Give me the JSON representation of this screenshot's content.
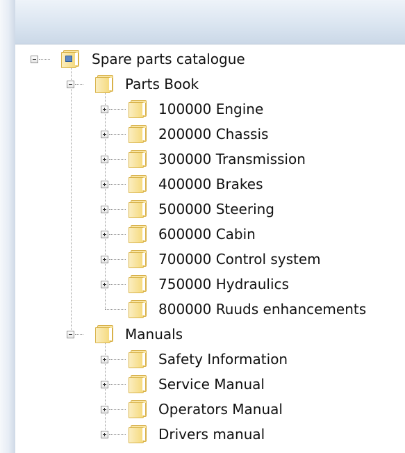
{
  "tree": {
    "root": {
      "label": "Spare parts catalogue"
    },
    "parts_book": {
      "label": "Parts Book",
      "items": [
        {
          "label": "100000 Engine"
        },
        {
          "label": "200000 Chassis"
        },
        {
          "label": "300000 Transmission"
        },
        {
          "label": "400000 Brakes"
        },
        {
          "label": "500000 Steering"
        },
        {
          "label": "600000 Cabin"
        },
        {
          "label": "700000 Control system"
        },
        {
          "label": "750000 Hydraulics"
        },
        {
          "label": "800000 Ruuds enhancements"
        }
      ]
    },
    "manuals": {
      "label": "Manuals",
      "items": [
        {
          "label": "Safety Information"
        },
        {
          "label": "Service Manual"
        },
        {
          "label": "Operators Manual"
        },
        {
          "label": "Drivers manual"
        }
      ]
    }
  },
  "icons": {
    "expanded": "collapse-box-icon",
    "collapsed": "expand-box-icon",
    "folder": "folder-icon"
  }
}
